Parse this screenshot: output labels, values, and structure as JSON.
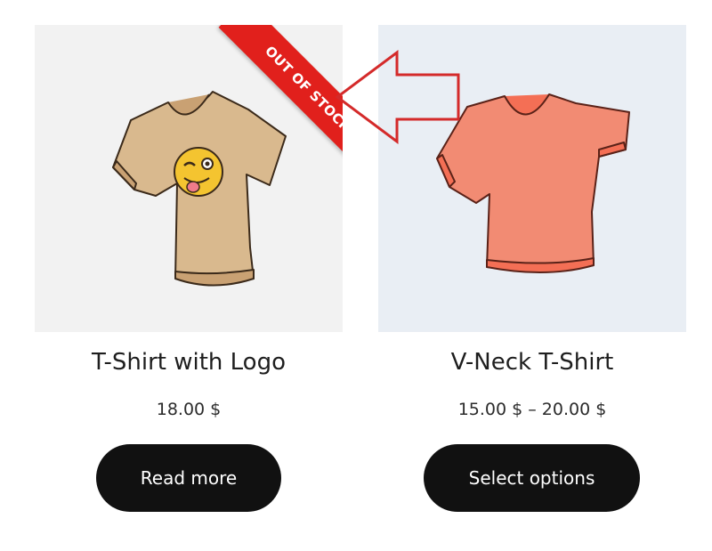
{
  "products": [
    {
      "title": "T-Shirt with Logo",
      "price": "18.00 $",
      "button_label": "Read more",
      "badge": "OUT OF STOCK",
      "shirt_color": "#d9b98e"
    },
    {
      "title": "V-Neck T-Shirt",
      "price": "15.00 $ – 20.00 $",
      "button_label": "Select options",
      "shirt_color": "#f28b73"
    }
  ],
  "colors": {
    "badge": "#e1201c",
    "button": "#111111",
    "arrow": "#d42a2a"
  }
}
